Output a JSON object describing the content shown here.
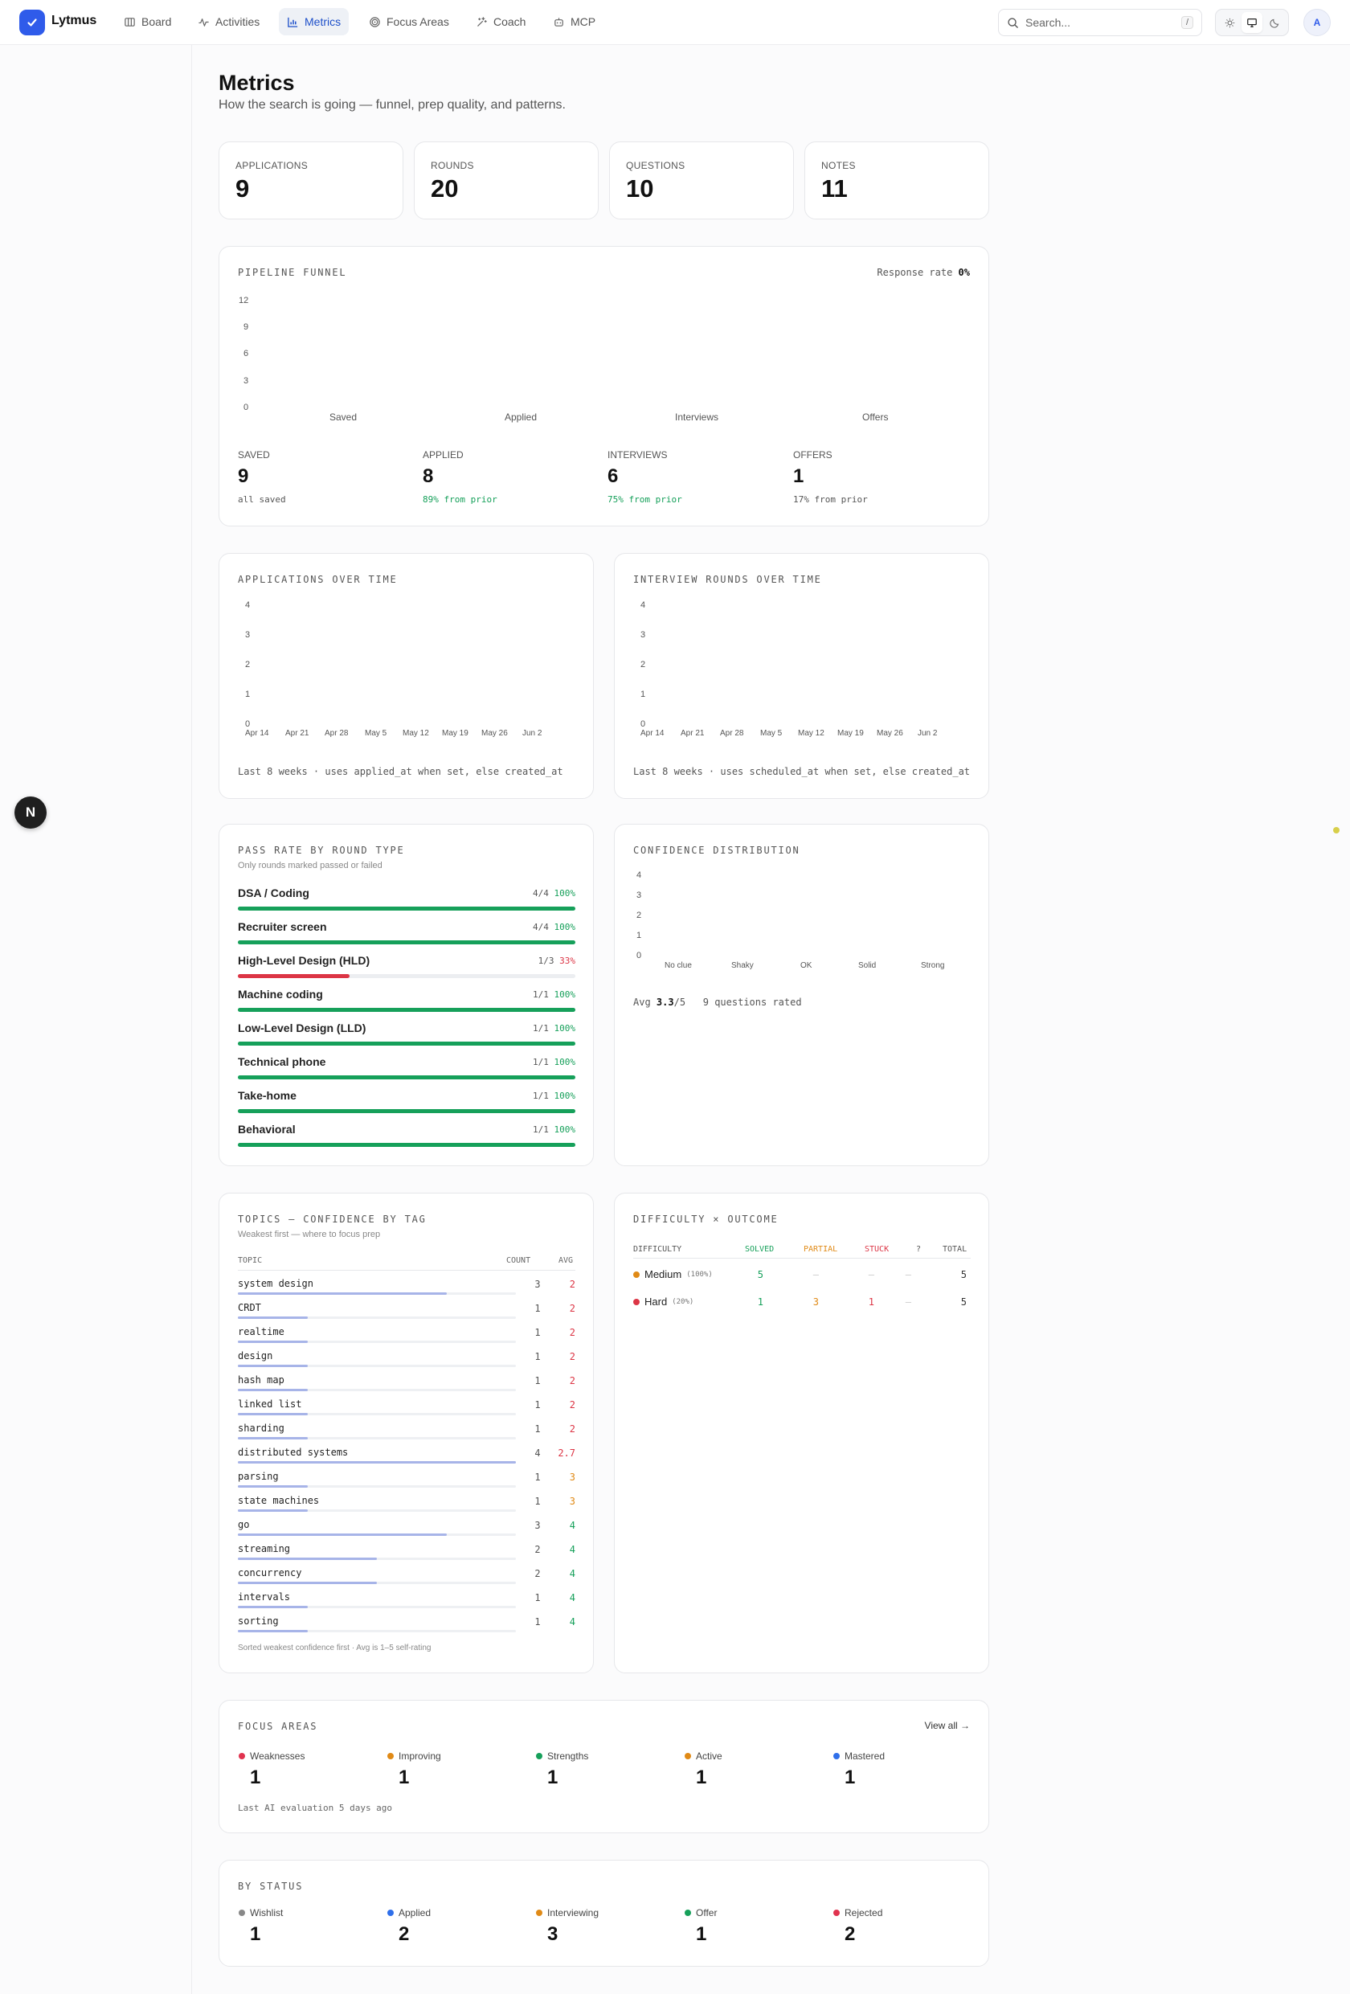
{
  "nav": {
    "brand": "Lytmus",
    "items": [
      {
        "label": "Board",
        "icon": "board-icon"
      },
      {
        "label": "Activities",
        "icon": "activity-icon"
      },
      {
        "label": "Metrics",
        "icon": "chart-icon",
        "active": true
      },
      {
        "label": "Focus Areas",
        "icon": "target-icon"
      },
      {
        "label": "Coach",
        "icon": "sparkle-icon"
      },
      {
        "label": "MCP",
        "icon": "robot-icon"
      }
    ],
    "search_placeholder": "Search...",
    "search_shortcut": "/",
    "avatar": "A",
    "floating_badge": "N"
  },
  "page": {
    "title": "Metrics",
    "subtitle": "How the search is going — funnel, prep quality, and patterns."
  },
  "stats": [
    {
      "label": "APPLICATIONS",
      "value": "9"
    },
    {
      "label": "ROUNDS",
      "value": "20"
    },
    {
      "label": "QUESTIONS",
      "value": "10"
    },
    {
      "label": "NOTES",
      "value": "11"
    }
  ],
  "funnel": {
    "title": "PIPELINE FUNNEL",
    "response_rate_label": "Response rate",
    "response_rate_value": "0%",
    "y_ticks": [
      "12",
      "9",
      "6",
      "3",
      "0"
    ],
    "stages": [
      {
        "label": "SAVED",
        "short": "Saved",
        "value": "9",
        "note": "all saved"
      },
      {
        "label": "APPLIED",
        "short": "Applied",
        "value": "8",
        "note": "89% from prior"
      },
      {
        "label": "INTERVIEWS",
        "short": "Interviews",
        "value": "6",
        "note": "75% from prior"
      },
      {
        "label": "OFFERS",
        "short": "Offers",
        "value": "1",
        "note": "17% from prior"
      }
    ]
  },
  "apps_over_time": {
    "title": "APPLICATIONS OVER TIME",
    "y_ticks": [
      "4",
      "3",
      "2",
      "1",
      "0"
    ],
    "x_ticks": [
      "Apr 14",
      "Apr 21",
      "Apr 28",
      "May 5",
      "May 12",
      "May 19",
      "May 26",
      "Jun 2"
    ],
    "footer": "Last 8 weeks · uses applied_at when set, else created_at"
  },
  "rounds_over_time": {
    "title": "INTERVIEW ROUNDS OVER TIME",
    "y_ticks": [
      "4",
      "3",
      "2",
      "1",
      "0"
    ],
    "x_ticks": [
      "Apr 14",
      "Apr 21",
      "Apr 28",
      "May 5",
      "May 12",
      "May 19",
      "May 26",
      "Jun 2"
    ],
    "footer": "Last 8 weeks · uses scheduled_at when set, else created_at"
  },
  "pass_rate": {
    "title": "PASS RATE BY ROUND TYPE",
    "subtitle": "Only rounds marked passed or failed",
    "rows": [
      {
        "name": "DSA / Coding",
        "frac": "4/4",
        "pct": "100%",
        "rate": 1.0
      },
      {
        "name": "Recruiter screen",
        "frac": "4/4",
        "pct": "100%",
        "rate": 1.0
      },
      {
        "name": "High-Level Design (HLD)",
        "frac": "1/3",
        "pct": "33%",
        "rate": 0.33
      },
      {
        "name": "Machine coding",
        "frac": "1/1",
        "pct": "100%",
        "rate": 1.0
      },
      {
        "name": "Low-Level Design (LLD)",
        "frac": "1/1",
        "pct": "100%",
        "rate": 1.0
      },
      {
        "name": "Technical phone",
        "frac": "1/1",
        "pct": "100%",
        "rate": 1.0
      },
      {
        "name": "Take-home",
        "frac": "1/1",
        "pct": "100%",
        "rate": 1.0
      },
      {
        "name": "Behavioral",
        "frac": "1/1",
        "pct": "100%",
        "rate": 1.0
      }
    ]
  },
  "confidence": {
    "title": "CONFIDENCE DISTRIBUTION",
    "y_ticks": [
      "4",
      "3",
      "2",
      "1",
      "0"
    ],
    "x_ticks": [
      "No clue",
      "Shaky",
      "OK",
      "Solid",
      "Strong"
    ],
    "avg_label": "Avg",
    "avg_value": "3.3",
    "avg_suffix": "/5",
    "rated": "9 questions rated"
  },
  "topics": {
    "title": "TOPICS — CONFIDENCE BY TAG",
    "subtitle": "Weakest first — where to focus prep",
    "col_topic": "TOPIC",
    "col_count": "COUNT",
    "col_avg": "AVG",
    "rows": [
      {
        "name": "system design",
        "count": "3",
        "avg": "2",
        "share": 0.75
      },
      {
        "name": "CRDT",
        "count": "1",
        "avg": "2",
        "share": 0.25
      },
      {
        "name": "realtime",
        "count": "1",
        "avg": "2",
        "share": 0.25
      },
      {
        "name": "design",
        "count": "1",
        "avg": "2",
        "share": 0.25
      },
      {
        "name": "hash map",
        "count": "1",
        "avg": "2",
        "share": 0.25
      },
      {
        "name": "linked list",
        "count": "1",
        "avg": "2",
        "share": 0.25
      },
      {
        "name": "sharding",
        "count": "1",
        "avg": "2",
        "share": 0.25
      },
      {
        "name": "distributed systems",
        "count": "4",
        "avg": "2.7",
        "share": 1.0
      },
      {
        "name": "parsing",
        "count": "1",
        "avg": "3",
        "share": 0.25
      },
      {
        "name": "state machines",
        "count": "1",
        "avg": "3",
        "share": 0.25
      },
      {
        "name": "go",
        "count": "3",
        "avg": "4",
        "share": 0.75
      },
      {
        "name": "streaming",
        "count": "2",
        "avg": "4",
        "share": 0.5
      },
      {
        "name": "concurrency",
        "count": "2",
        "avg": "4",
        "share": 0.5
      },
      {
        "name": "intervals",
        "count": "1",
        "avg": "4",
        "share": 0.25
      },
      {
        "name": "sorting",
        "count": "1",
        "avg": "4",
        "share": 0.25
      }
    ],
    "footer": "Sorted weakest confidence first · Avg is 1–5 self-rating"
  },
  "difficulty": {
    "title": "DIFFICULTY × OUTCOME",
    "headers": [
      "DIFFICULTY",
      "SOLVED",
      "PARTIAL",
      "STUCK",
      "?",
      "TOTAL"
    ],
    "rows": [
      {
        "name": "Medium",
        "pct": "(100%)",
        "solved": "5",
        "partial": "—",
        "stuck": "—",
        "unknown": "—",
        "total": "5",
        "color": "#e08a16"
      },
      {
        "name": "Hard",
        "pct": "(20%)",
        "solved": "1",
        "partial": "3",
        "stuck": "1",
        "unknown": "—",
        "total": "5",
        "color": "#dc3545"
      }
    ]
  },
  "focus_areas": {
    "title": "FOCUS AREAS",
    "view_all": "View all →",
    "items": [
      {
        "label": "Weaknesses",
        "value": "1",
        "color": "#e0334f"
      },
      {
        "label": "Improving",
        "value": "1",
        "color": "#e08a16"
      },
      {
        "label": "Strengths",
        "value": "1",
        "color": "#16a05a"
      },
      {
        "label": "Active",
        "value": "1",
        "color": "#e08a16"
      },
      {
        "label": "Mastered",
        "value": "1",
        "color": "#2f6fea"
      }
    ],
    "footer": "Last AI evaluation 5 days ago"
  },
  "by_status": {
    "title": "BY STATUS",
    "items": [
      {
        "label": "Wishlist",
        "value": "1",
        "color": "#888888"
      },
      {
        "label": "Applied",
        "value": "2",
        "color": "#2f6fea"
      },
      {
        "label": "Interviewing",
        "value": "3",
        "color": "#e08a16"
      },
      {
        "label": "Offer",
        "value": "1",
        "color": "#16a05a"
      },
      {
        "label": "Rejected",
        "value": "2",
        "color": "#e0334f"
      }
    ]
  }
}
